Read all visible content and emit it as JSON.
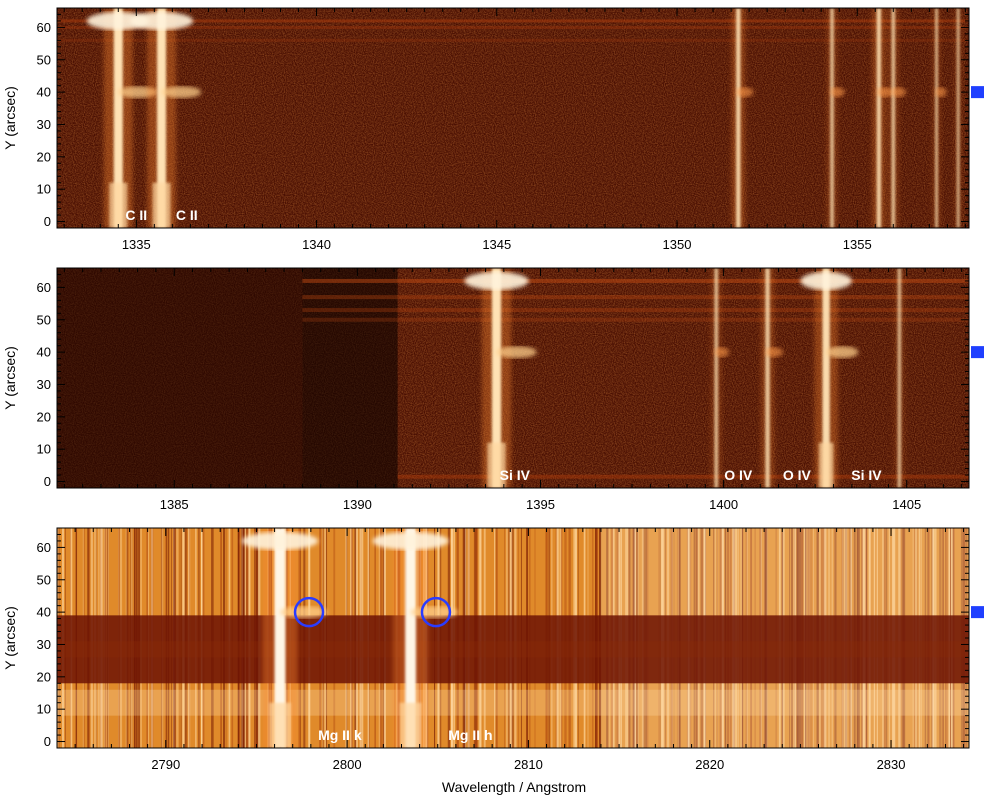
{
  "figure": {
    "xlabel": "Wavelength / Angstrom",
    "ylabel": "Y (arcsec)"
  },
  "colors": {
    "marker": "#1f3fff",
    "circle": "#2a3cff",
    "frame": "#000000"
  },
  "chart_data": [
    {
      "type": "heatmap",
      "xlabel": "",
      "ylabel": "Y (arcsec)",
      "xlim": [
        1332.8,
        1358.1
      ],
      "ylim": [
        -2,
        66
      ],
      "xticks": [
        1335,
        1340,
        1345,
        1350,
        1355
      ],
      "yticks": [
        0,
        10,
        20,
        30,
        40,
        50,
        60
      ],
      "background": "dark-noise",
      "marker_y": 40,
      "lines": [
        {
          "x": 1334.5,
          "label": "C II",
          "strength": 1.0,
          "width": 0.25
        },
        {
          "x": 1335.7,
          "label": "C II",
          "strength": 1.0,
          "width": 0.25
        },
        {
          "x": 1351.7,
          "label": "",
          "strength": 0.8,
          "width": 0.12
        },
        {
          "x": 1354.3,
          "label": "",
          "strength": 0.5,
          "width": 0.1
        },
        {
          "x": 1355.6,
          "label": "",
          "strength": 0.75,
          "width": 0.12
        },
        {
          "x": 1356.0,
          "label": "",
          "strength": 0.5,
          "width": 0.1
        },
        {
          "x": 1357.2,
          "label": "",
          "strength": 0.4,
          "width": 0.08
        },
        {
          "x": 1357.8,
          "label": "",
          "strength": 0.35,
          "width": 0.08
        }
      ],
      "labels": [
        {
          "text": "C II",
          "x": 1335.0
        },
        {
          "text": "C II",
          "x": 1336.4
        }
      ]
    },
    {
      "type": "heatmap",
      "xlabel": "",
      "ylabel": "Y (arcsec)",
      "xlim": [
        1381.8,
        1406.7
      ],
      "ylim": [
        -2,
        66
      ],
      "xticks": [
        1385,
        1390,
        1395,
        1400,
        1405
      ],
      "yticks": [
        0,
        10,
        20,
        30,
        40,
        50,
        60
      ],
      "background": "dark-noise-band",
      "band_edges": [
        1388.5,
        1391.1
      ],
      "marker_y": 40,
      "lines": [
        {
          "x": 1393.8,
          "label": "Si IV",
          "strength": 1.0,
          "width": 0.25
        },
        {
          "x": 1399.8,
          "label": "",
          "strength": 0.45,
          "width": 0.1
        },
        {
          "x": 1401.2,
          "label": "O IV",
          "strength": 0.65,
          "width": 0.12
        },
        {
          "x": 1402.8,
          "label": "Si IV",
          "strength": 0.9,
          "width": 0.2
        },
        {
          "x": 1404.8,
          "label": "",
          "strength": 0.35,
          "width": 0.1
        }
      ],
      "labels": [
        {
          "text": "Si IV",
          "x": 1394.3
        },
        {
          "text": "O IV",
          "x": 1400.4
        },
        {
          "text": "O IV",
          "x": 1402.0
        },
        {
          "text": "Si IV",
          "x": 1403.9
        }
      ]
    },
    {
      "type": "heatmap",
      "xlabel": "Wavelength / Angstrom",
      "ylabel": "Y (arcsec)",
      "xlim": [
        2784.0,
        2834.3
      ],
      "ylim": [
        -2,
        66
      ],
      "xticks": [
        2790,
        2800,
        2810,
        2820,
        2830
      ],
      "yticks": [
        0,
        10,
        20,
        30,
        40,
        50,
        60
      ],
      "background": "bright-continuum",
      "dark_band_y": [
        18,
        39
      ],
      "marker_y": 40,
      "lines": [
        {
          "x": 2796.3,
          "label": "Mg II k",
          "strength": 1.0,
          "width": 0.6
        },
        {
          "x": 2803.5,
          "label": "Mg II h",
          "strength": 1.0,
          "width": 0.6
        }
      ],
      "circles": [
        {
          "x": 2797.9,
          "y": 40
        },
        {
          "x": 2804.9,
          "y": 40
        }
      ],
      "labels": [
        {
          "text": "Mg II k",
          "x": 2799.6
        },
        {
          "text": "Mg II h",
          "x": 2806.8
        }
      ]
    }
  ]
}
